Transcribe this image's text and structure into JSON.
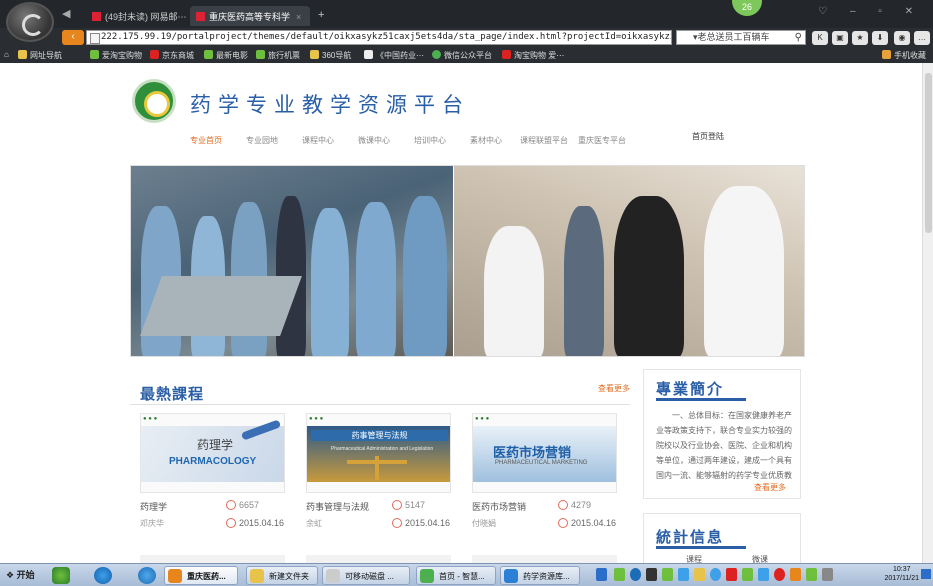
{
  "browser": {
    "tabs": [
      {
        "label": "(49封未读) 网易邮⋯",
        "active": false
      },
      {
        "label": "重庆医药高等专科学",
        "active": true
      }
    ],
    "new_tab": "+",
    "badge": "26",
    "window_controls": "♡ – ▫ ✕",
    "url": "222.175.99.19/portalproject/themes/default/oikxasykz51caxj5ets4da/sta_page/index.html?projectId=oikxasykz51caxj5e",
    "search_text": "▾老总送员工百辆车",
    "bookmarks": [
      "网址导航",
      "爱淘宝购物",
      "京东商城",
      "最新电影",
      "旅行机票",
      "360导航",
      "《中国药业⋯",
      "微信公众平台",
      "淘宝购物 爱⋯",
      "手机收藏"
    ]
  },
  "site": {
    "title": "药学专业教学资源平台",
    "menu": [
      "专业首页",
      "专业园地",
      "课程中心",
      "微课中心",
      "培训中心",
      "素材中心",
      "课程联盟平台",
      "重庆医专平台"
    ],
    "login": "首页登陆"
  },
  "hot_courses": {
    "heading": "最熱課程",
    "more": "查看更多",
    "courses": [
      {
        "name": "药理学",
        "teacher": "邓庆华",
        "count": "6657",
        "date": "2015.04.16",
        "art_title": "药理学",
        "art_sub": "PHARMACOLOGY"
      },
      {
        "name": "药事管理与法规",
        "teacher": "余虹",
        "count": "5147",
        "date": "2015.04.16",
        "art_title": "药事管理与法规",
        "art_sub": "Pharmaceutical Administration and Legislation"
      },
      {
        "name": "医药市场营销",
        "teacher": "付晓娟",
        "count": "4279",
        "date": "2015.04.16",
        "art_title": "医药市场营销",
        "art_sub": "PHARMACEUTICAL MARKETING"
      }
    ]
  },
  "intro": {
    "heading": "專業簡介",
    "text": "一、总体目标：在国家健康养老产业等政策支持下，联合专业实力较强的院校以及行业协会、医院、企业和机构等单位，通过两年建设，建成一个具有国内一流、能够辐射的药学专业优质教",
    "more": "查看更多"
  },
  "stats": {
    "heading": "統計信息",
    "labels": [
      "课程",
      "微课"
    ]
  },
  "taskbar": {
    "start": "开始",
    "tasks": [
      "重庆医药...",
      "新建文件夹",
      "可移动磁盘 ...",
      "首页 - 智慧...",
      "药学资源库..."
    ],
    "clock_time": "10:37",
    "clock_date": "2017/11/21"
  },
  "colors": {
    "brand_blue": "#2a5fa8",
    "accent_orange": "#e16b1f",
    "chrome_dark": "#2a2e33"
  }
}
